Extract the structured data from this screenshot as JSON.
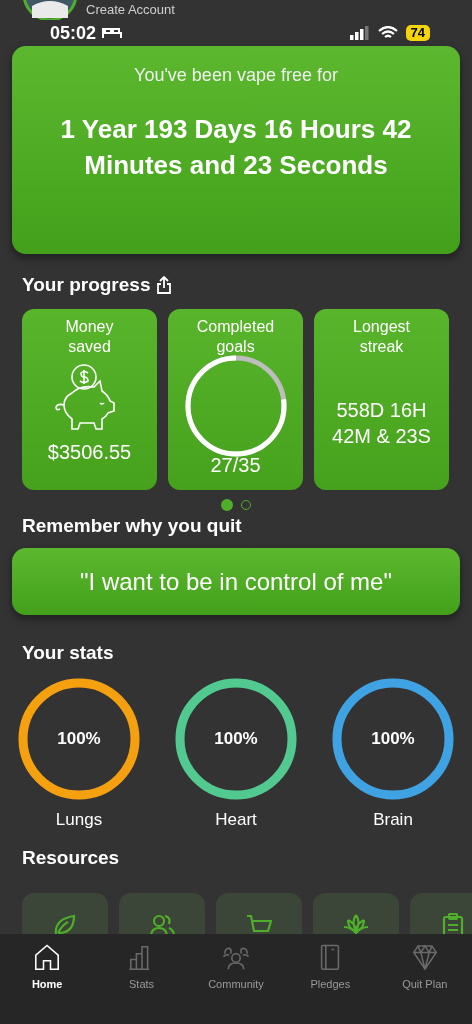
{
  "account": {
    "label": "Create Account"
  },
  "status_bar": {
    "time": "05:02",
    "battery": "74"
  },
  "hero": {
    "caption": "You've been vape free for",
    "duration": "1 Year 193 Days 16 Hours 42 Minutes and 23 Seconds"
  },
  "progress": {
    "title": "Your progress",
    "cards": [
      {
        "kind": "money",
        "title": "Money saved",
        "value": "$3506.55"
      },
      {
        "kind": "goals",
        "title": "Completed goals",
        "value": "27/35",
        "level": 0.771
      },
      {
        "kind": "streak",
        "title": "Longest streak",
        "value": "558D 16H 42M & 23S"
      }
    ],
    "pages": [
      {
        "selected": true
      },
      {
        "selected": false
      }
    ]
  },
  "reason": {
    "title": "Remember why you quit",
    "quote": "\"I want to be in control of me\""
  },
  "stats": {
    "title": "Your stats",
    "items": [
      {
        "label": "Lungs",
        "value": "100%",
        "level": 1,
        "color": "#f5a00f"
      },
      {
        "label": "Heart",
        "value": "100%",
        "level": 1,
        "color": "#52c98f"
      },
      {
        "label": "Brain",
        "value": "100%",
        "level": 1,
        "color": "#3fa2e3"
      }
    ]
  },
  "resources": {
    "title": "Resources",
    "tiles": [
      {
        "kind": "leaf"
      },
      {
        "kind": "people"
      },
      {
        "kind": "cart"
      },
      {
        "kind": "lotus"
      },
      {
        "kind": "clipboard"
      }
    ]
  },
  "tab_bar": [
    {
      "label": "Home",
      "kind": "home",
      "selected": true
    },
    {
      "label": "Stats",
      "kind": "stats",
      "selected": false
    },
    {
      "label": "Community",
      "kind": "community",
      "selected": false
    },
    {
      "label": "Pledges",
      "kind": "pledges",
      "selected": false
    },
    {
      "label": "Quit Plan",
      "kind": "plan",
      "selected": false
    }
  ]
}
